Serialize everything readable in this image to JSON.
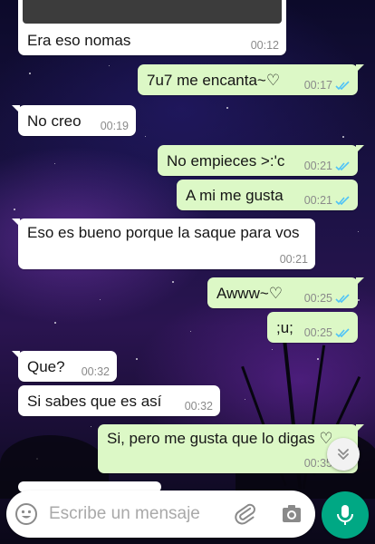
{
  "chat": {
    "messages": [
      {
        "id": "m1",
        "dir": "in",
        "text": "Era eso nomas",
        "time": "00:12"
      },
      {
        "id": "m2",
        "dir": "out",
        "text": "7u7 me encanta~♡",
        "time": "00:17"
      },
      {
        "id": "m3",
        "dir": "in",
        "text": "No creo",
        "time": "00:19"
      },
      {
        "id": "m4",
        "dir": "out",
        "text": "No empieces >:'c",
        "time": "00:21"
      },
      {
        "id": "m5",
        "dir": "out",
        "text": "A mi me gusta",
        "time": "00:21"
      },
      {
        "id": "m6",
        "dir": "in",
        "text": "Eso es bueno porque la saque para vos",
        "time": "00:21"
      },
      {
        "id": "m7",
        "dir": "out",
        "text": "Awww~♡",
        "time": "00:25"
      },
      {
        "id": "m8",
        "dir": "out",
        "text": ";u;",
        "time": "00:25"
      },
      {
        "id": "m9",
        "dir": "in",
        "text": "Que?",
        "time": "00:32"
      },
      {
        "id": "m10",
        "dir": "in",
        "text": "Si sabes que es así",
        "time": "00:32"
      },
      {
        "id": "m11",
        "dir": "out",
        "text": "Si, pero me gusta que lo digas ♡",
        "time": "00:35"
      }
    ]
  },
  "composer": {
    "placeholder": "Escribe un mensaje"
  },
  "icons": {
    "emoji": "emoji-icon",
    "attach": "paperclip-icon",
    "camera": "camera-icon",
    "mic": "microphone-icon",
    "scroll": "double-chevron-down-icon",
    "read": "double-check-icon"
  },
  "colors": {
    "incoming_bubble": "#ffffff",
    "outgoing_bubble": "#dcf8c6",
    "read_ticks": "#4fc3f7",
    "accent": "#00a884"
  }
}
